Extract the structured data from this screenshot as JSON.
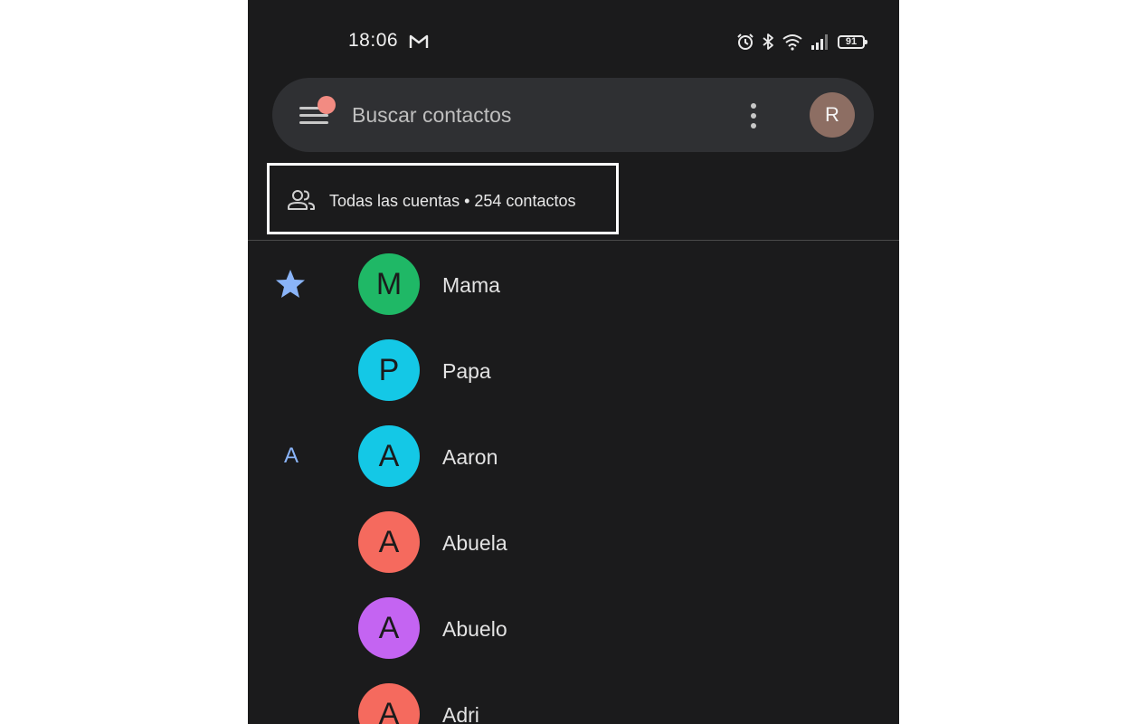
{
  "status_bar": {
    "time": "18:06",
    "notification_icon": "gmail-icon",
    "icons": [
      "alarm-icon",
      "bluetooth-icon",
      "wifi-icon",
      "signal-icon"
    ],
    "battery_level": "91"
  },
  "search": {
    "placeholder": "Buscar contactos",
    "menu_icon": "hamburger-menu-icon",
    "more_icon": "more-vert-icon",
    "profile_initial": "R",
    "profile_color": "#8d6e63",
    "notification_dot_color": "#f28b82"
  },
  "account_filter": {
    "label": "Todas las cuentas • 254 contactos",
    "icon": "people-icon"
  },
  "contacts": [
    {
      "marker": "★",
      "marker_type": "star-icon",
      "initial": "M",
      "name": "Mama",
      "color": "#1fb866"
    },
    {
      "marker": "",
      "marker_type": "",
      "initial": "P",
      "name": "Papa",
      "color": "#14c8e6"
    },
    {
      "marker": "A",
      "marker_type": "section-letter",
      "initial": "A",
      "name": "Aaron",
      "color": "#14c8e6"
    },
    {
      "marker": "",
      "marker_type": "",
      "initial": "A",
      "name": "Abuela",
      "color": "#f56a5e"
    },
    {
      "marker": "",
      "marker_type": "",
      "initial": "A",
      "name": "Abuelo",
      "color": "#c464f2"
    },
    {
      "marker": "",
      "marker_type": "",
      "initial": "A",
      "name": "Adri",
      "color": "#f56a5e"
    }
  ],
  "colors": {
    "background": "#1b1b1c",
    "search_bar": "#2f3033",
    "accent": "#8ab4f8",
    "highlight_border": "#ffffff"
  }
}
